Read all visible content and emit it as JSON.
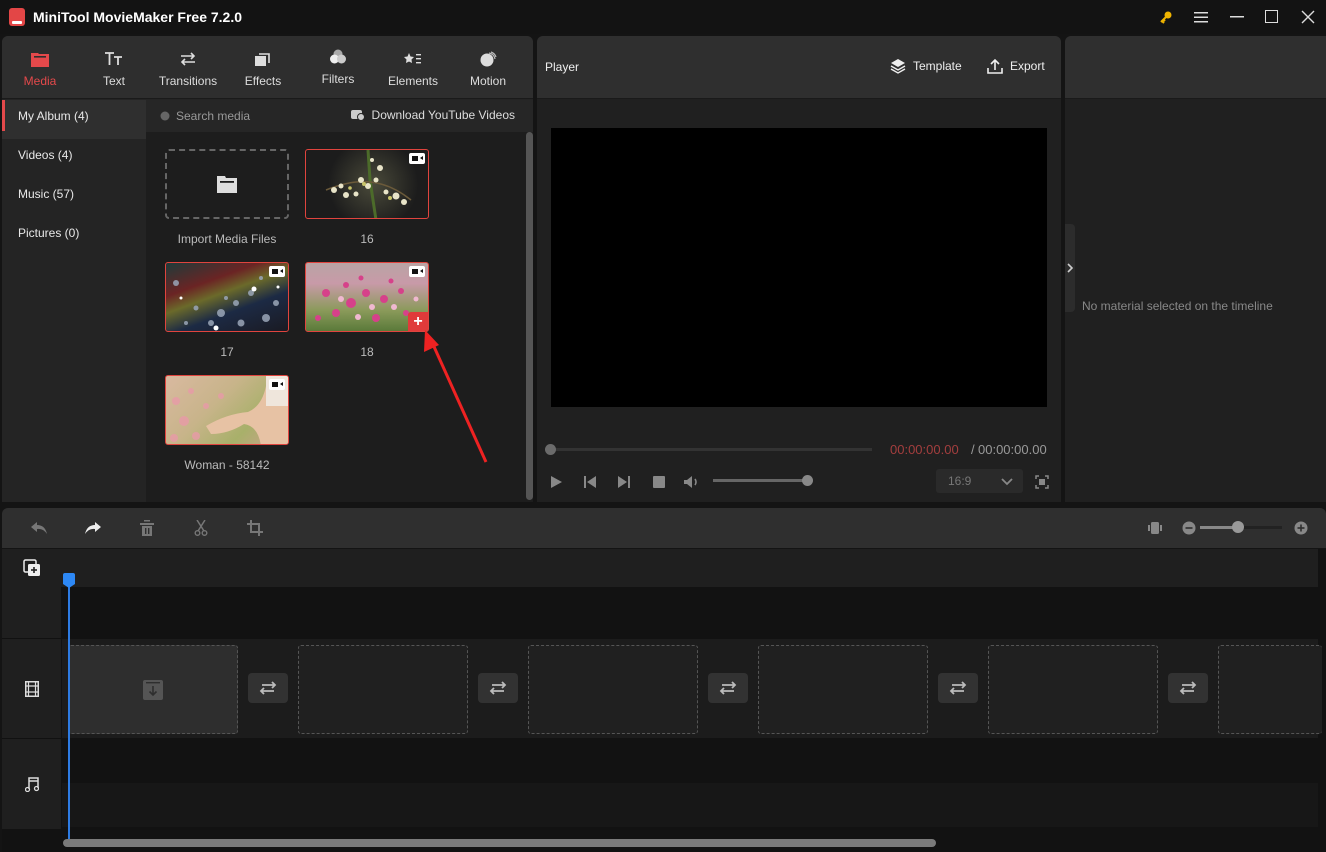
{
  "app": {
    "title": "MiniTool MovieMaker Free 7.2.0"
  },
  "titlebar": {
    "icons": [
      "key-icon",
      "menu-icon",
      "minimize-icon",
      "maximize-icon",
      "close-icon"
    ]
  },
  "toolbar": {
    "tabs": [
      {
        "label": "Media",
        "icon": "folder-icon",
        "active": true
      },
      {
        "label": "Text",
        "icon": "text-icon"
      },
      {
        "label": "Transitions",
        "icon": "transitions-icon"
      },
      {
        "label": "Effects",
        "icon": "effects-icon"
      },
      {
        "label": "Filters",
        "icon": "filters-icon"
      },
      {
        "label": "Elements",
        "icon": "elements-icon"
      },
      {
        "label": "Motion",
        "icon": "motion-icon"
      }
    ],
    "accent_color": "#e4494b"
  },
  "categories": [
    {
      "label": "My Album (4)",
      "active": true
    },
    {
      "label": "Videos (4)"
    },
    {
      "label": "Music (57)"
    },
    {
      "label": "Pictures (0)"
    }
  ],
  "media": {
    "search_placeholder": "Search media",
    "download_label": "Download YouTube Videos",
    "import_label": "Import Media Files",
    "items": [
      {
        "label": "16",
        "type": "video"
      },
      {
        "label": "17",
        "type": "video"
      },
      {
        "label": "18",
        "type": "video",
        "hover_add": "+"
      },
      {
        "label": "Woman - 58142",
        "type": "video"
      }
    ]
  },
  "player": {
    "title": "Player",
    "template_label": "Template",
    "export_label": "Export",
    "time_current": "00:00:00.00",
    "time_separator": "/",
    "time_total": "00:00:00.00",
    "progress": 0,
    "volume": 1.0,
    "aspect_ratio": "16:9",
    "time_color": "#a33e3e"
  },
  "properties": {
    "empty_text": "No material selected on the timeline"
  },
  "timeline": {
    "tools": [
      "undo-icon",
      "redo-icon",
      "delete-icon",
      "split-icon",
      "crop-icon"
    ],
    "zoom_level": 0.45,
    "playhead_color": "#2d88f5",
    "slot_count": 6
  }
}
